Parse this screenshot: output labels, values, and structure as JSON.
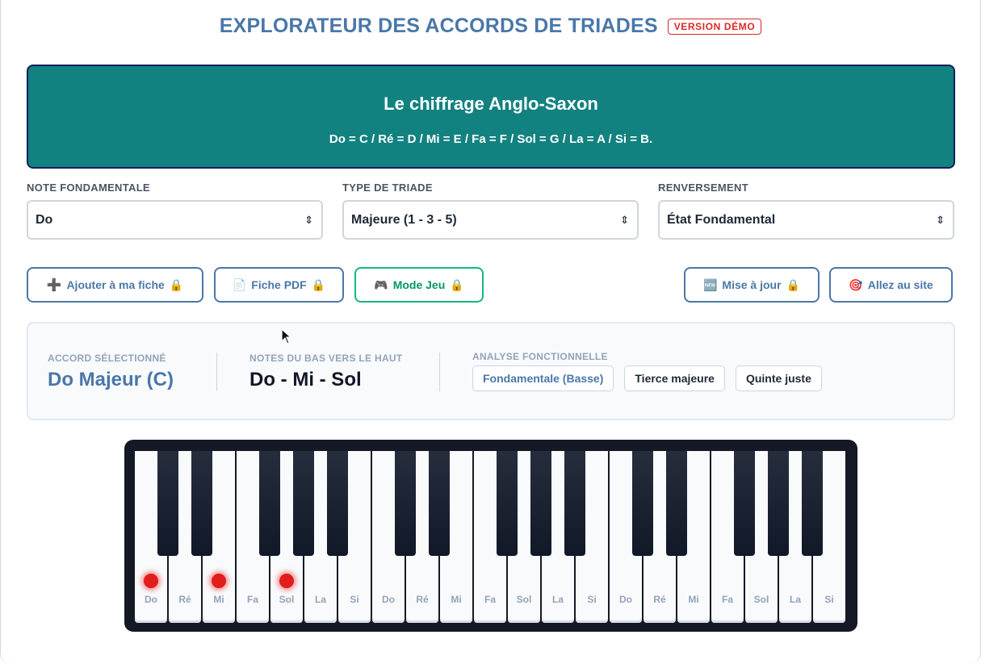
{
  "header": {
    "title": "EXPLORATEUR DES ACCORDS DE TRIADES",
    "badge": "VERSION DÉMO"
  },
  "banner": {
    "title": "Le chiffrage Anglo-Saxon",
    "subtitle": "Do = C / Ré = D / Mi = E / Fa = F / Sol = G / La = A / Si = B."
  },
  "selectors": {
    "root": {
      "label": "NOTE FONDAMENTALE",
      "value": "Do"
    },
    "type": {
      "label": "TYPE DE TRIADE",
      "value": "Majeure (1 - 3 - 5)"
    },
    "inversion": {
      "label": "RENVERSEMENT",
      "value": "État Fondamental"
    }
  },
  "actions": {
    "add": {
      "icon": "➕",
      "label": "Ajouter à ma fiche",
      "lock": "🔒"
    },
    "pdf": {
      "icon": "📄",
      "label": "Fiche PDF",
      "lock": "🔒"
    },
    "game": {
      "icon": "🎮",
      "label": "Mode Jeu",
      "lock": "🔒"
    },
    "update": {
      "icon": "🆕",
      "label": "Mise à jour",
      "lock": "🔒"
    },
    "site": {
      "icon": "🎯",
      "label": "Allez au site"
    }
  },
  "info": {
    "chord_label": "ACCORD SÉLECTIONNÉ",
    "chord_name": "Do Majeur (C)",
    "notes_label": "NOTES DU BAS VERS LE HAUT",
    "notes": "Do - Mi - Sol",
    "analysis_label": "ANALYSE FONCTIONNELLE",
    "analysis": [
      "Fondamentale (Basse)",
      "Tierce majeure",
      "Quinte juste"
    ]
  },
  "piano": {
    "white_keys": [
      "Do",
      "Ré",
      "Mi",
      "Fa",
      "Sol",
      "La",
      "Si",
      "Do",
      "Ré",
      "Mi",
      "Fa",
      "Sol",
      "La",
      "Si",
      "Do",
      "Ré",
      "Mi",
      "Fa",
      "Sol",
      "La",
      "Si"
    ],
    "active_indices": [
      0,
      2,
      4
    ]
  },
  "colors": {
    "accent": "#4a77a8",
    "banner": "#128280",
    "active_note": "#e11d1d",
    "game": "#10b981",
    "badge": "#dc2626"
  }
}
